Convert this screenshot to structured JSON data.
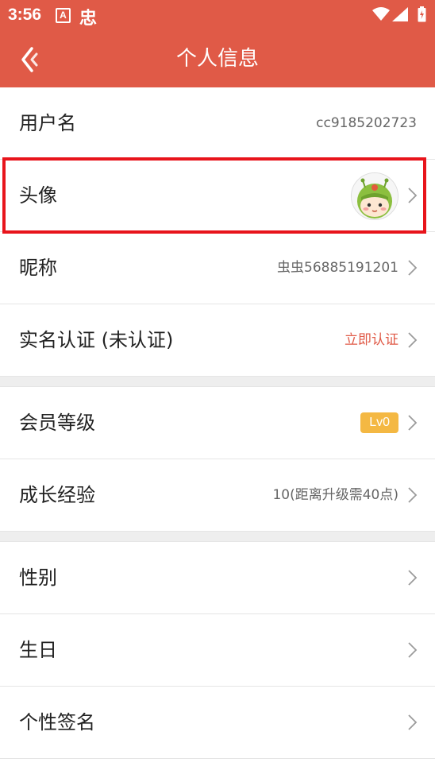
{
  "status_bar": {
    "time": "3:56",
    "notif_a": "A",
    "app_glyph": "忠"
  },
  "header": {
    "title": "个人信息",
    "back_icon": "chevron-left-icon"
  },
  "rows": {
    "username": {
      "label": "用户名",
      "value": "cc9185202723"
    },
    "avatar": {
      "label": "头像"
    },
    "nickname": {
      "label": "昵称",
      "value": "虫虫56885191201"
    },
    "realname": {
      "label": "实名认证 (未认证)",
      "value": "立即认证"
    },
    "level": {
      "label": "会员等级",
      "badge": "Lv0"
    },
    "growth": {
      "label": "成长经验",
      "value": "10(距离升级需40点)"
    },
    "gender": {
      "label": "性别"
    },
    "birthday": {
      "label": "生日"
    },
    "signature": {
      "label": "个性签名"
    }
  },
  "colors": {
    "brand": "#e05a47",
    "badge": "#f4b843",
    "highlight": "#e8141b",
    "action": "#e05a47"
  }
}
